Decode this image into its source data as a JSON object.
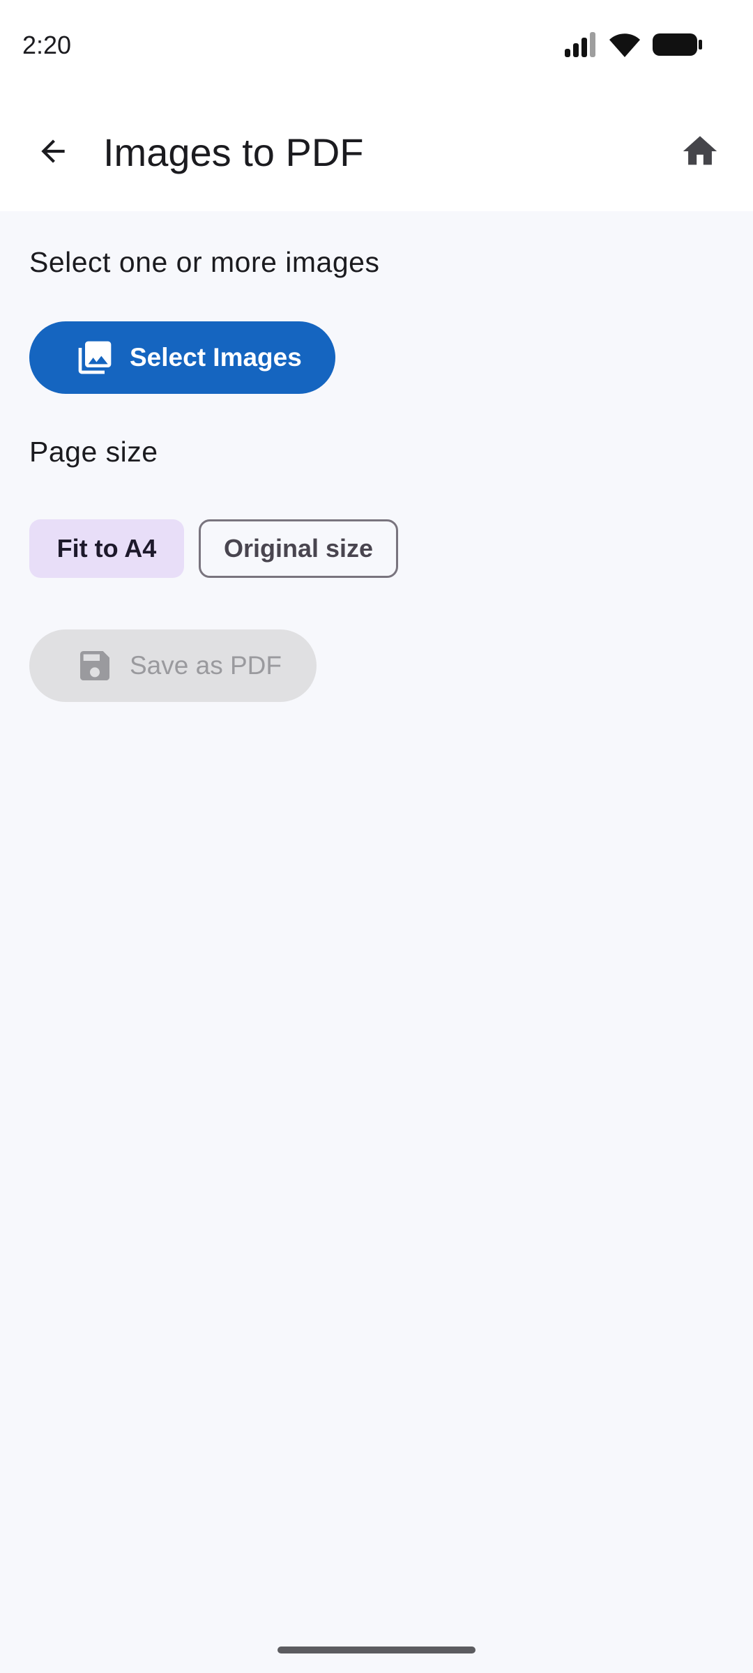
{
  "status_bar": {
    "time": "2:20",
    "icons": [
      "signal-icon",
      "wifi-icon",
      "battery-icon"
    ]
  },
  "app_bar": {
    "title": "Images to PDF",
    "back_icon": "arrow-back-icon",
    "home_icon": "home-icon"
  },
  "main": {
    "select_prompt": "Select one or more images",
    "select_button_label": "Select Images",
    "page_size_label": "Page size",
    "page_size_options": [
      {
        "label": "Fit to A4",
        "selected": true
      },
      {
        "label": "Original size",
        "selected": false
      }
    ],
    "save_button_label": "Save as PDF",
    "save_button_enabled": false
  },
  "colors": {
    "primary": "#1565c0",
    "chip_selected": "#e8def8",
    "disabled_bg": "#e0e0e2",
    "background": "#f7f8fc"
  }
}
